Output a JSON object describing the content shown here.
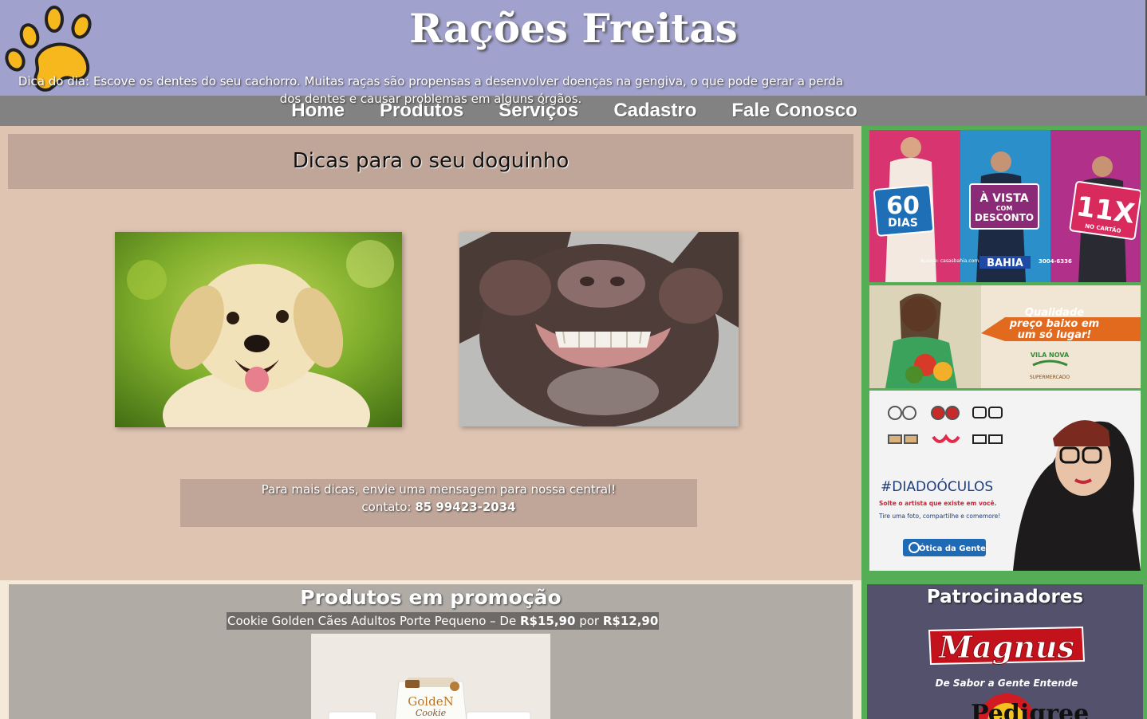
{
  "header": {
    "site_title": "Rações Freitas",
    "logo_icon": "paw-icon",
    "colors": {
      "header_bg": "#a1a1cd",
      "paw": "#f7b81e"
    }
  },
  "nav": {
    "items": [
      {
        "label": "Home"
      },
      {
        "label": "Produtos"
      },
      {
        "label": "Serviços"
      },
      {
        "label": "Cadastro"
      },
      {
        "label": "Fale Conosco"
      }
    ]
  },
  "tips": {
    "title": "Dicas para o seu doguinho",
    "tip_of_day": "Dica do dia: Escove os dentes do seu cachorro. Muitas raças são propensas a desenvolver doenças na gengiva, o que pode gerar a perda dos dentes e causar problemas em alguns órgãos."
  },
  "contact": {
    "line1": "Para mais dicas, envie uma mensagem para nossa central!",
    "label": "contato: ",
    "phone": "85 99423-2034"
  },
  "promo": {
    "title": "Produtos em promoção",
    "product": "Cookie Golden Cães Adultos Porte Pequeno – De ",
    "old_price": "R$15,90",
    "between": " por ",
    "new_price": "R$12,90",
    "package_brand": "GoldeN",
    "package_sub": "Cookie"
  },
  "ads": {
    "casas_bahia": {
      "badge1_big": "60",
      "badge1_small": "DIAS",
      "badge2_line1": "À VISTA",
      "badge2_line2": "COM",
      "badge2_line3": "DESCONTO",
      "badge3_big": "11X",
      "badge3_small": "NO CARTÃO",
      "brand": "BAHIA",
      "site": "Acesse: casasbahia.com.br",
      "phone": "3004-6336"
    },
    "supermercado": {
      "line1": "Qualidade",
      "line2": "preço baixo em",
      "line3": "um só lugar!",
      "brand": "VILA NOVA",
      "brand_sub": "SUPERMERCADO"
    },
    "otica": {
      "hashtag": "#DIADOÓCULOS",
      "line1": "Solte o artista que existe em você.",
      "line2": "Tire uma foto, compartilhe e comemore!",
      "brand": "Ótica da Gente"
    }
  },
  "sponsors": {
    "title": "Patrocinadores",
    "brand1": "Magnus",
    "brand1_slogan": "De Sabor a Gente Entende",
    "brand2": "Pedigree"
  }
}
